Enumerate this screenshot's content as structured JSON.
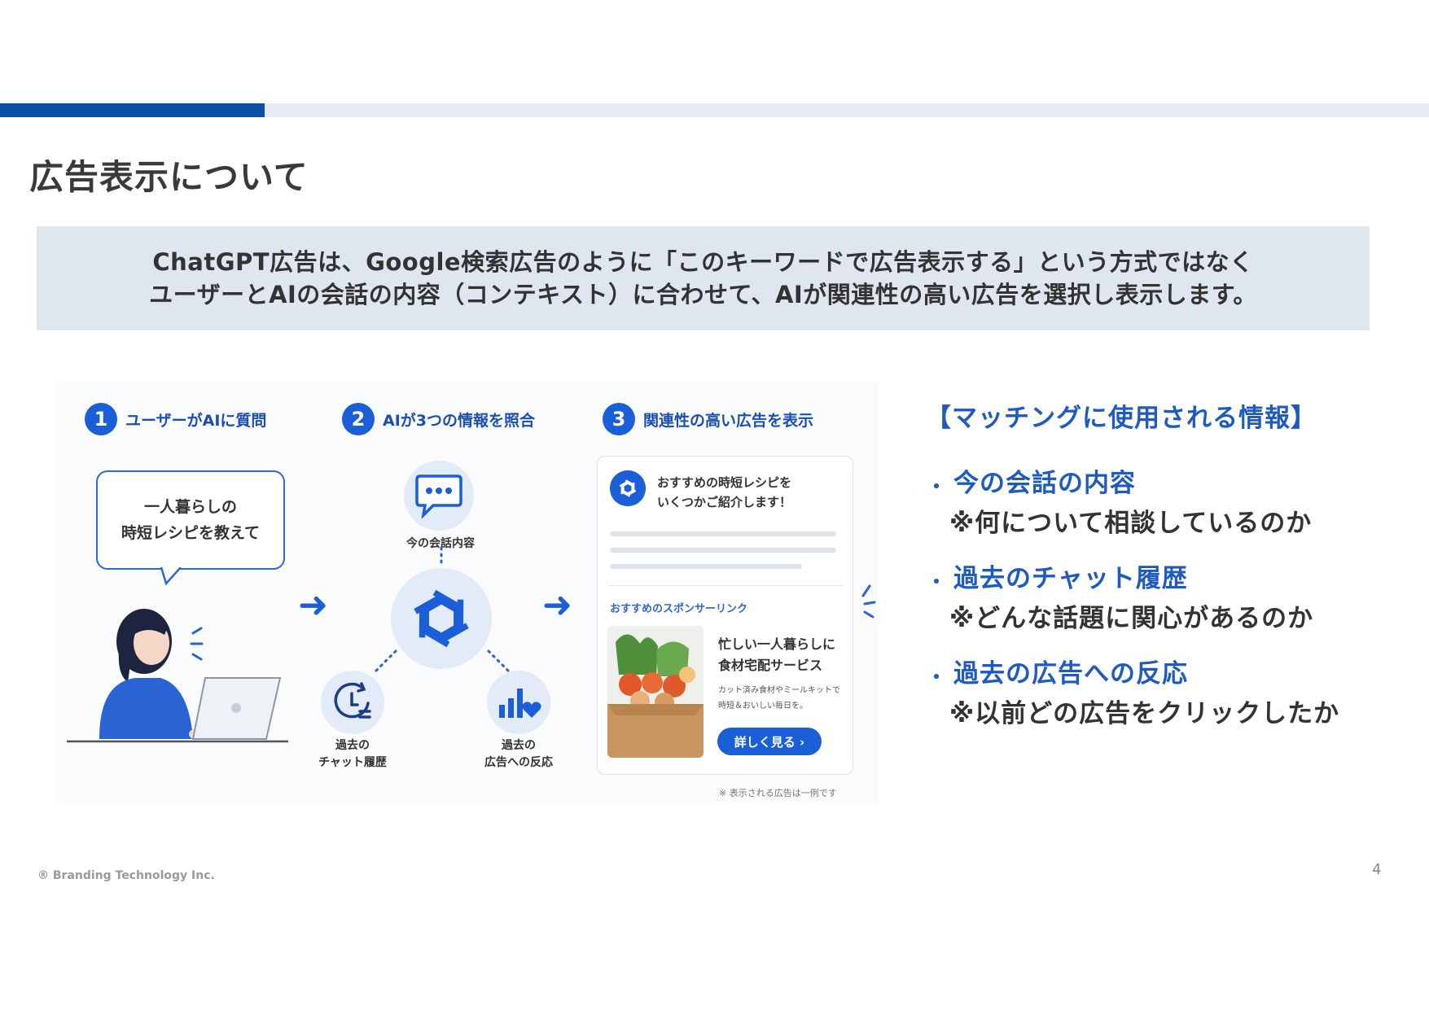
{
  "title": "広告表示について",
  "summary": {
    "line1": "ChatGPT広告は、Google検索広告のように「このキーワードで広告表示する」という方式ではなく",
    "line2": "ユーザーとAIの会話の内容（コンテキスト）に合わせて、AIが関連性の高い広告を選択し表示します。"
  },
  "figure": {
    "steps": [
      {
        "num": "1",
        "label": "ユーザーがAIに質問"
      },
      {
        "num": "2",
        "label": "AIが3つの情報を照合"
      },
      {
        "num": "3",
        "label": "関連性の高い広告を表示"
      }
    ],
    "bubble": {
      "line1": "一人暮らしの",
      "line2": "時短レシピを教えて"
    },
    "sources": {
      "conversation": "今の会話内容",
      "history_line1": "過去の",
      "history_line2": "チャット履歴",
      "reaction_line1": "過去の",
      "reaction_line2": "広告への反応"
    },
    "ad_card": {
      "message_line1": "おすすめの時短レシピを",
      "message_line2": "いくつかご紹介します！",
      "sponsor_label": "おすすめのスポンサーリンク",
      "ad_title_line1": "忙しい一人暮らしに",
      "ad_title_line2": "食材宅配サービス",
      "ad_desc_line1": "カット済み食材やミールキットで",
      "ad_desc_line2": "時短＆おいしい毎日を。",
      "cta": "詳しく見る ›"
    },
    "disclaimer": "※ 表示される広告は一例です"
  },
  "matching": {
    "title": "【マッチングに使用される情報】",
    "items": [
      {
        "bullet": "・",
        "head": "今の会話の内容",
        "note": "※何について相談しているのか"
      },
      {
        "bullet": "・",
        "head": "過去のチャット履歴",
        "note": "※どんな話題に関心があるのか"
      },
      {
        "bullet": "・",
        "head": "過去の広告への反応",
        "note": "※以前どの広告をクリックしたか"
      }
    ]
  },
  "footer": {
    "copyright": "® Branding Technology Inc.",
    "page": "4"
  },
  "colors": {
    "accent": "#0d4ea6",
    "bar": "#e6ebf3",
    "summary_bg": "#dfe6f0",
    "blue": "#1a5ed8",
    "heading_blue": "#1f5bbf"
  }
}
